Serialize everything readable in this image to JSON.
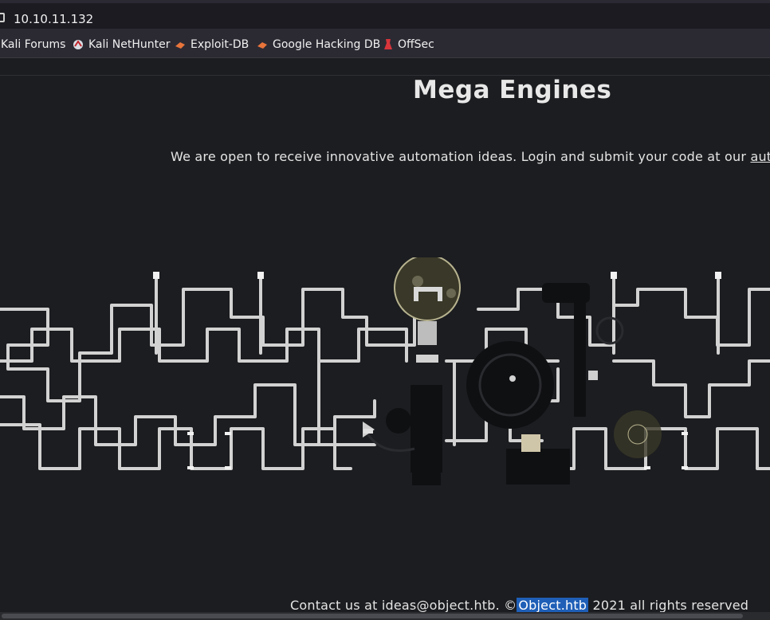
{
  "browser": {
    "url": "10.10.11.132",
    "bookmarks": [
      {
        "label": "Kali Forums",
        "icon": "kali-forums-icon"
      },
      {
        "label": "Kali NetHunter",
        "icon": "kali-nethunter-icon"
      },
      {
        "label": "Exploit-DB",
        "icon": "exploit-db-icon"
      },
      {
        "label": "Google Hacking DB",
        "icon": "ghdb-icon"
      },
      {
        "label": "OffSec",
        "icon": "offsec-icon"
      }
    ]
  },
  "page": {
    "title": "Mega Engines",
    "intro_text": "We are open to receive innovative automation ideas. Login and submit your code at our ",
    "intro_link": "autom",
    "footer_prefix": "Contact us at ideas@object.htb. ©",
    "footer_selected": "Object.htb",
    "footer_suffix": " 2021 all rights reserved"
  },
  "colors": {
    "page_bg": "#1c1d20",
    "pipes": "#d2d2d2",
    "selection": "#1f5fb7"
  }
}
